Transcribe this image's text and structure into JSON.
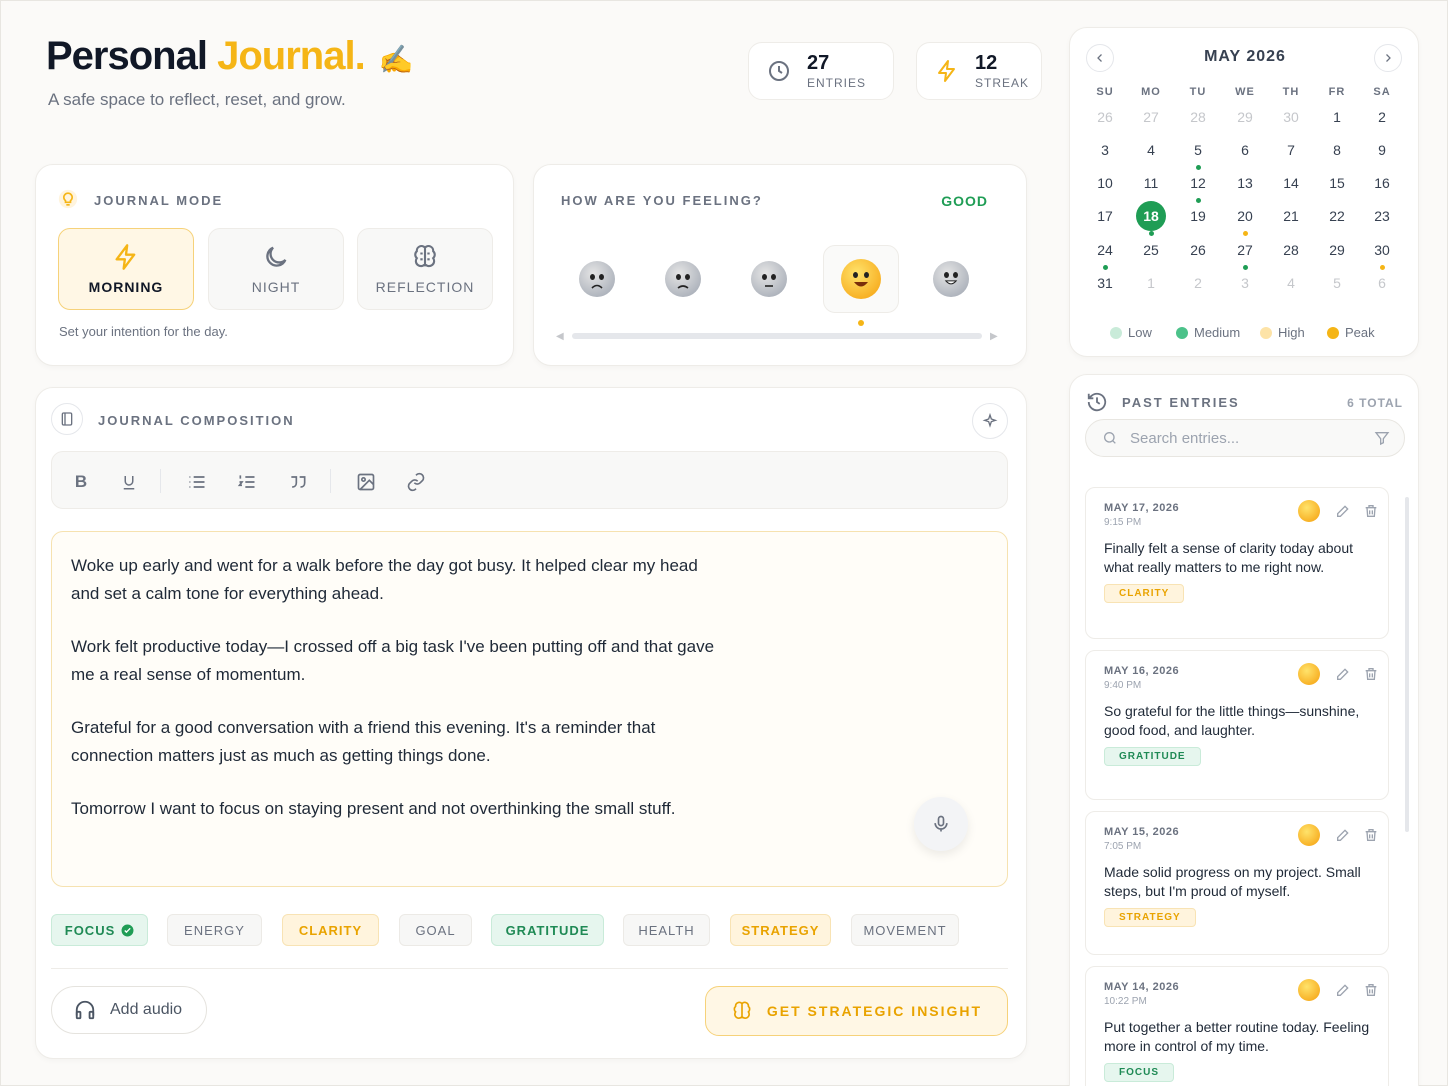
{
  "header": {
    "title_main": "Personal",
    "title_accent": "Journal.",
    "title_emoji": "✍️",
    "subtitle": "A safe space to reflect, reset, and grow."
  },
  "stats": {
    "entries": {
      "value": "27",
      "label": "ENTRIES",
      "icon": "clock-icon"
    },
    "streak": {
      "value": "12",
      "label": "STREAK",
      "icon": "lightning-icon"
    }
  },
  "journal_mode": {
    "label": "JOURNAL MODE",
    "options": [
      {
        "label": "MORNING",
        "icon": "lightning-icon",
        "active": true
      },
      {
        "label": "NIGHT",
        "icon": "moon-icon",
        "active": false
      },
      {
        "label": "REFLECTION",
        "icon": "brain-icon",
        "active": false
      }
    ],
    "hint": "Set your intention for the day."
  },
  "mood": {
    "label": "HOW ARE YOU FEELING?",
    "current": "GOOD",
    "selected_index": 3,
    "options": [
      "very-sad-emoji",
      "sad-emoji",
      "neutral-emoji",
      "good-emoji",
      "great-emoji"
    ]
  },
  "composition": {
    "label": "JOURNAL COMPOSITION",
    "toolbar": [
      "bold-icon",
      "underline-icon",
      "bullet-list-icon",
      "numbered-list-icon",
      "quote-icon",
      "image-icon",
      "link-icon"
    ],
    "paragraphs": [
      "Woke up early and went for a walk before the day got busy. It helped clear my head and set a calm tone for everything ahead.",
      "Work felt productive today—I crossed off a big task I've been putting off and that gave me a real sense of momentum.",
      "Grateful for a good conversation with a friend this evening. It's a reminder that connection matters just as much as getting things done.",
      "Tomorrow I want to focus on staying present and not overthinking the small stuff."
    ],
    "tags": [
      {
        "label": "FOCUS",
        "style": "green",
        "checked": true
      },
      {
        "label": "ENERGY",
        "style": "gray"
      },
      {
        "label": "CLARITY",
        "style": "yellow"
      },
      {
        "label": "GOAL",
        "style": "gray"
      },
      {
        "label": "GRATITUDE",
        "style": "green"
      },
      {
        "label": "HEALTH",
        "style": "gray"
      },
      {
        "label": "STRATEGY",
        "style": "yellow"
      },
      {
        "label": "MOVEMENT",
        "style": "gray"
      }
    ],
    "add_audio": "Add audio",
    "insight_button": "GET STRATEGIC INSIGHT"
  },
  "calendar": {
    "title": "MAY 2026",
    "weekdays": [
      "SU",
      "MO",
      "TU",
      "WE",
      "TH",
      "FR",
      "SA"
    ],
    "weeks": [
      [
        "26",
        "27",
        "28",
        "29",
        "30",
        "1",
        "2"
      ],
      [
        "3",
        "4",
        "5",
        "6",
        "7",
        "8",
        "9"
      ],
      [
        "10",
        "11",
        "12",
        "13",
        "14",
        "15",
        "16"
      ],
      [
        "17",
        "18",
        "19",
        "20",
        "21",
        "22",
        "23"
      ],
      [
        "24",
        "25",
        "26",
        "27",
        "28",
        "29",
        "30"
      ],
      [
        "31",
        "1",
        "2",
        "3",
        "4",
        "5",
        "6"
      ]
    ],
    "selected": "18",
    "legend": [
      {
        "label": "Low",
        "color": "#c9ebd9"
      },
      {
        "label": "Medium",
        "color": "#4cc28a"
      },
      {
        "label": "High",
        "color": "#fde3a7"
      },
      {
        "label": "Peak",
        "color": "#f5b516"
      }
    ]
  },
  "past_entries": {
    "label": "PAST ENTRIES",
    "total": "6 TOTAL",
    "search_placeholder": "Search entries...",
    "entries": [
      {
        "date": "MAY 17, 2026",
        "time": "9:15 PM",
        "text": "Finally felt a sense of clarity today about what really matters to me right now.",
        "tag": "CLARITY",
        "tag_style": "yellow"
      },
      {
        "date": "MAY 16, 2026",
        "time": "9:40 PM",
        "text": "So grateful for the little things—sunshine, good food, and laughter.",
        "tag": "GRATITUDE",
        "tag_style": "green"
      },
      {
        "date": "MAY 15, 2026",
        "time": "7:05 PM",
        "text": "Made solid progress on my project. Small steps, but I'm proud of myself.",
        "tag": "STRATEGY",
        "tag_style": "yellow"
      },
      {
        "date": "MAY 14, 2026",
        "time": "10:22 PM",
        "text": "Put together a better routine today. Feeling more in control of my time.",
        "tag": "FOCUS",
        "tag_style": "green"
      }
    ]
  },
  "colors": {
    "accent": "#f5b516",
    "green": "#1f9d55",
    "text": "#111827"
  }
}
